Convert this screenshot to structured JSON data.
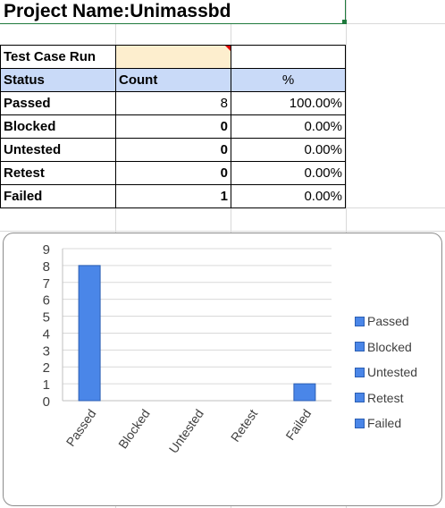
{
  "title": "Project Name:Unimassbd",
  "table": {
    "run_label": "Test Case Run",
    "run_value": "",
    "headers": {
      "status": "Status",
      "count": "Count",
      "percent": "%"
    },
    "rows": [
      {
        "status": "Passed",
        "count": "8",
        "percent": "100.00%"
      },
      {
        "status": "Blocked",
        "count": "0",
        "percent": "0.00%"
      },
      {
        "status": "Untested",
        "count": "0",
        "percent": "0.00%"
      },
      {
        "status": "Retest",
        "count": "0",
        "percent": "0.00%"
      },
      {
        "status": "Failed",
        "count": "1",
        "percent": "0.00%"
      }
    ]
  },
  "chart_data": {
    "type": "bar",
    "categories": [
      "Passed",
      "Blocked",
      "Untested",
      "Retest",
      "Failed"
    ],
    "values": [
      8,
      0,
      0,
      0,
      1
    ],
    "ylim": [
      0,
      9
    ],
    "yticks": [
      "0",
      "1",
      "2",
      "3",
      "4",
      "5",
      "6",
      "7",
      "8",
      "9"
    ],
    "grid": true,
    "legend_position": "right",
    "legend": [
      "Passed",
      "Blocked",
      "Untested",
      "Retest",
      "Failed"
    ],
    "bar_color": "#4a86e8"
  }
}
